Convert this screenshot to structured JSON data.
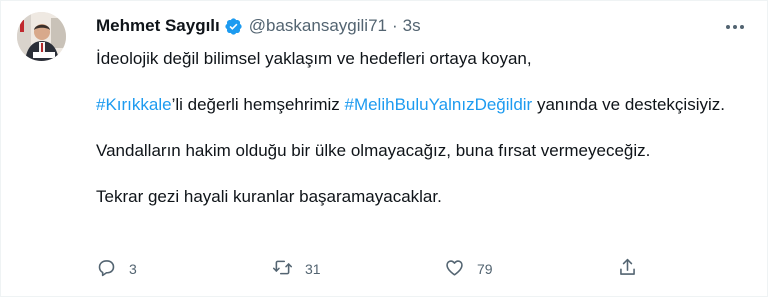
{
  "author": {
    "name": "Mehmet Saygılı",
    "handle": "@baskansaygili71",
    "separator": "·",
    "time": "3s"
  },
  "tweet": {
    "line1": "İdeolojik değil bilimsel yaklaşım ve hedefleri ortaya koyan,",
    "hashtag1": "#Kırıkkale",
    "text_after_hashtag1": "’li değerli hemşehrimiz ",
    "hashtag2": "#MelihBuluYalnızDeğildir",
    "text_after_hashtag2": " yanında ve destekçisiyiz.",
    "line3": "Vandalların hakim olduğu bir ülke olmayacağız, buna fırsat vermeyeceğiz.",
    "line4": "Tekrar gezi hayali kuranlar başaramayacaklar."
  },
  "actions": {
    "reply_count": "3",
    "retweet_count": "31",
    "like_count": "79"
  },
  "icons": [
    "verified-badge-icon",
    "more-icon",
    "reply-icon",
    "retweet-icon",
    "like-icon",
    "share-icon"
  ],
  "colors": {
    "link": "#1d9bf0",
    "muted": "#536471",
    "text": "#0f1419"
  }
}
